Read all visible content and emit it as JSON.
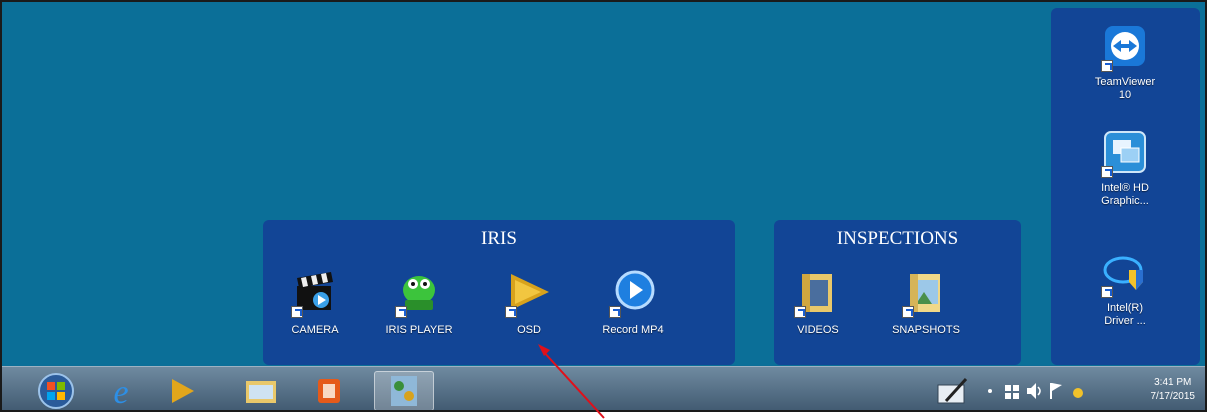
{
  "desktop": {
    "fences": {
      "iris": {
        "title": "IRIS",
        "items": [
          {
            "label": "CAMERA",
            "icon": "clapperboard-icon"
          },
          {
            "label": "IRIS PLAYER",
            "icon": "green-alien-icon"
          },
          {
            "label": "OSD",
            "icon": "osd-play-icon"
          },
          {
            "label": "Record MP4",
            "icon": "blue-play-circle-icon"
          }
        ]
      },
      "inspections": {
        "title": "INSPECTIONS",
        "items": [
          {
            "label": "VIDEOS",
            "icon": "folder-icon"
          },
          {
            "label": "SNAPSHOTS",
            "icon": "folder-icon"
          }
        ]
      },
      "right": {
        "items": [
          {
            "label_line1": "TeamViewer",
            "label_line2": "10",
            "icon": "teamviewer-icon"
          },
          {
            "label_line1": "Intel® HD",
            "label_line2": "Graphic...",
            "icon": "intel-graphics-icon"
          },
          {
            "label_line1": "Intel(R)",
            "label_line2": "Driver ...",
            "icon": "intel-driver-icon"
          }
        ]
      }
    }
  },
  "taskbar": {
    "start": "windows-start-icon",
    "pinned": [
      "internet-explorer-icon",
      "media-player-icon",
      "file-explorer-icon",
      "video-app-icon",
      "control-panel-icon"
    ],
    "tray": {
      "icons": [
        "pen-tablet-icon",
        "show-hidden-icon",
        "network-icon",
        "volume-icon",
        "action-center-flag-icon",
        "power-icon"
      ],
      "time": "3:41 PM",
      "date": "7/17/2015"
    }
  },
  "colors": {
    "desktop": "#0b6f98",
    "fence": "#143c96",
    "taskbar": "#4b6680",
    "annotation_arrow": "#e0101a"
  }
}
